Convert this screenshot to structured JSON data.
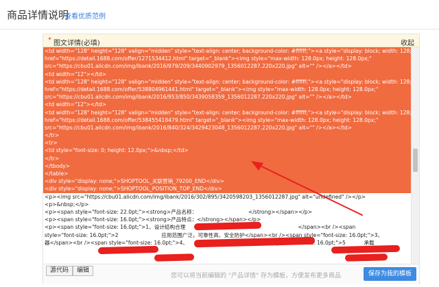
{
  "header": {
    "title": "商品详情说明",
    "example_link": "查看优质范例"
  },
  "panel": {
    "required_mark": "*",
    "title": "图文详情(必填)",
    "collapse": "收起"
  },
  "editor": {
    "selected_lines": [
      "<td width=\"128\" height=\"128\" valign=\"midden\" style=\"text-align: center; background-color: #ffffff;\"><a style=\"display: block; width: 128;\"",
      "href=\"https://detail.1688.com/offer/1271534412.html\" target=\"_blank\"><img style=\"max-width: 128.0px; height: 128.0px;\"",
      "src=\"https://cbu01.alicdn.com/img/ibank/2016/979/209/3440902979_1356012287.220x220.jpg\" alt=\"\" /></a></td>",
      "<td width=\"12\"></td>",
      "<td width=\"128\" height=\"128\" valign=\"midden\" style=\"text-align: center; background-color: #ffffff;\"><a style=\"display: block; width: 128;\"",
      "href=\"https://detail.1688.com/offer/538804961441.html\" target=\"_blank\"><img style=\"max-width: 128.0px; height: 128.0px;\"",
      "src=\"https://cbu01.alicdn.com/img/ibank/2016/953/850/3439058359_1356012287.220x220.jpg\" alt=\"\" /></a></td>",
      "<td width=\"12\"></td>",
      "<td width=\"128\" height=\"128\" valign=\"midden\" style=\"text-align: center; background-color: #ffffff;\"><a style=\"display: block; width: 128;\"",
      "href=\"https://detail.1688.com/offer/538455418479.html\" target=\"_blank\"><img style=\"max-width: 128.0px; height: 128.0px;\"",
      "src=\"https://cbu01.alicdn.com/img/ibank/2016/840/324/3429423048_1356012287.220x220.jpg\" alt=\"\" /></a></td>",
      "</tr>",
      "<tr>",
      "<td style=\"font-size: 0; height: 12.0px;\">&nbsp;</td>",
      "</tr>",
      "</tbody>",
      "</table>",
      "<div style=\"display: none;\">SHOPTOOL_关联营销_79200_END</div>",
      "<div style=\"display: none;\">SHOPTOOL_POSITION_TOP_END</div>"
    ],
    "normal_lines": [
      "<p><img src=\"https://cbu01.alicdn.com/img/ibank/2016/302/895/3420598203_1356012287.jpg\" alt=\"undefined\" /></p>",
      "<p>&nbsp;</p>",
      "<p><span style=\"font-size: 22.0pt;\"><strong>产品名称：                               </strong></span></p>",
      "<p><span style=\"font-size: 16.0pt;\"><strong>产品特点：</strong></span></p>",
      "<p><span style=\"font-size: 16.0pt;\">1、设计结构合理                                                                    </span><br /><span",
      "style=\"font-size: 16.0pt;\">2                          应用范围广泛，可靠性高、安全防护</span><br /><span style=\"font-size: 16.0pt;\">3、                      检",
      "器</span><br /><span style=\"font-size: 16.0pt;\">4、               </span><br /><span style=\"font-size: 16.0pt;\">5           承载"
    ]
  },
  "footer": {
    "tabs": [
      "源代码",
      "编辑"
    ],
    "hint": "您可以将当前编辑的 \"产品详情\" 存为模板，方便发布更多商品",
    "save_button": "保存为我的模板"
  }
}
